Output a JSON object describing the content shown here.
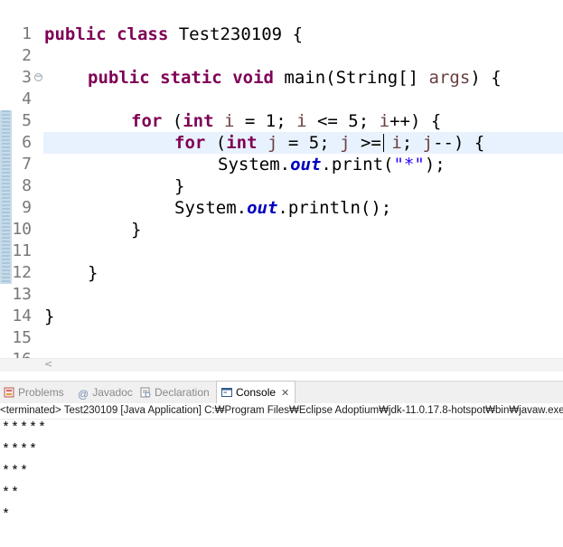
{
  "editor": {
    "lines": [
      {
        "n": "1"
      },
      {
        "n": "2"
      },
      {
        "n": "3"
      },
      {
        "n": "4"
      },
      {
        "n": "5"
      },
      {
        "n": "6"
      },
      {
        "n": "7"
      },
      {
        "n": "8"
      },
      {
        "n": "9"
      },
      {
        "n": "10"
      },
      {
        "n": "11"
      },
      {
        "n": "12"
      },
      {
        "n": "13"
      },
      {
        "n": "14"
      },
      {
        "n": "15"
      },
      {
        "n": "16"
      }
    ],
    "code": {
      "l2": {
        "kw1": "public",
        "kw2": "class",
        "rest": " Test230109 {"
      },
      "l4": {
        "kw1": "public",
        "kw2": "static",
        "kw3": "void",
        "rest1": " main(String[] ",
        "var": "args",
        "rest2": ") {"
      },
      "l6": {
        "kw1": "for",
        "t1": " (",
        "kw2": "int",
        "t2": " ",
        "v1": "i",
        "t3": " = 1; ",
        "v2": "i",
        "t4": " <= 5; ",
        "v3": "i",
        "t5": "++) {"
      },
      "l7": {
        "kw1": "for",
        "t1": " (",
        "kw2": "int",
        "t2": " ",
        "v1": "j",
        "t3": " = 5; ",
        "v2": "j",
        "t4": " >= ",
        "v3": "i",
        "t5": "; ",
        "v4": "j",
        "t6": "--) {"
      },
      "l8": {
        "t1": "System.",
        "fld": "out",
        "t2": ".print(",
        "str": "\"*\"",
        "t3": ");"
      },
      "l9": {
        "t": "}"
      },
      "l10": {
        "t1": "System.",
        "fld": "out",
        "t2": ".println();"
      },
      "l11": {
        "t": "}"
      },
      "l13": {
        "t": "}"
      },
      "l15": {
        "t": "}"
      }
    },
    "fold_marker": "−",
    "scroll_left": "<"
  },
  "tabs": {
    "problems": "Problems",
    "javadoc": "Javadoc",
    "declaration": "Declaration",
    "console": "Console",
    "close": "✕"
  },
  "console": {
    "status": "<terminated> Test230109 [Java Application] C:₩Program Files₩Eclipse Adoptium₩jdk-11.0.17.8-hotspot₩bin₩javaw.exe",
    "output": [
      "*****",
      "****",
      "***",
      "**",
      "*"
    ]
  },
  "colors": {
    "keyword": "#7f0055",
    "local_variable": "#6a3e3e",
    "static_field": "#0000c0",
    "string": "#2a00ff",
    "current_line": "#e8f2fe"
  },
  "icons": {
    "problems": "problems-icon",
    "javadoc": "javadoc-icon",
    "declaration": "declaration-icon",
    "console": "console-icon",
    "close": "close-icon"
  }
}
